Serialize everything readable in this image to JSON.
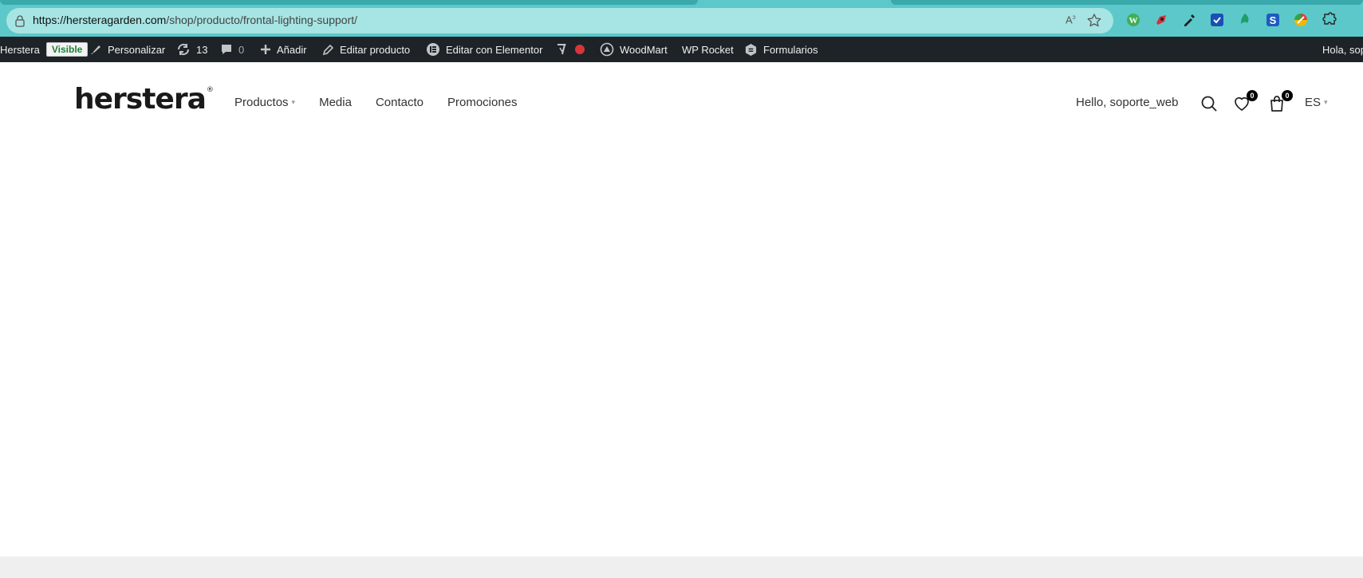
{
  "browser": {
    "url_host": "https://hersteragarden.com",
    "url_path": "/shop/producto/frontal-lighting-support/",
    "read_aloud_icon": "read-aloud-icon",
    "favorite_icon": "star-icon",
    "extensions": [
      "wordpress-icon",
      "rocket-ext-icon",
      "eyedropper-icon",
      "todo-check-icon",
      "leaf-ext-icon",
      "s-ext-icon",
      "color-wheel-icon",
      "puzzle-icon"
    ]
  },
  "adminbar": {
    "site_name": "Herstera",
    "visibility_badge": "Visible",
    "customize": "Personalizar",
    "updates_count": "13",
    "comments_count": "0",
    "add_new": "Añadir",
    "edit_product": "Editar producto",
    "edit_elementor": "Editar con Elementor",
    "woodmart": "WoodMart",
    "wp_rocket": "WP Rocket",
    "forms": "Formularios",
    "greeting": "Hola, sop"
  },
  "header": {
    "logo_text": "herstera",
    "logo_mark": "®",
    "nav": [
      "Productos",
      "Media",
      "Contacto",
      "Promociones"
    ],
    "hello_user": "Hello, soporte_web",
    "wishlist_count": "0",
    "cart_count": "0",
    "language": "ES"
  },
  "colors": {
    "browser_chrome": "#5cc8c9",
    "address_bar": "#a6e5e3",
    "adminbar_bg": "#1d2327",
    "visible_badge_text": "#1a7f37",
    "seo_dot": "#d63638"
  }
}
